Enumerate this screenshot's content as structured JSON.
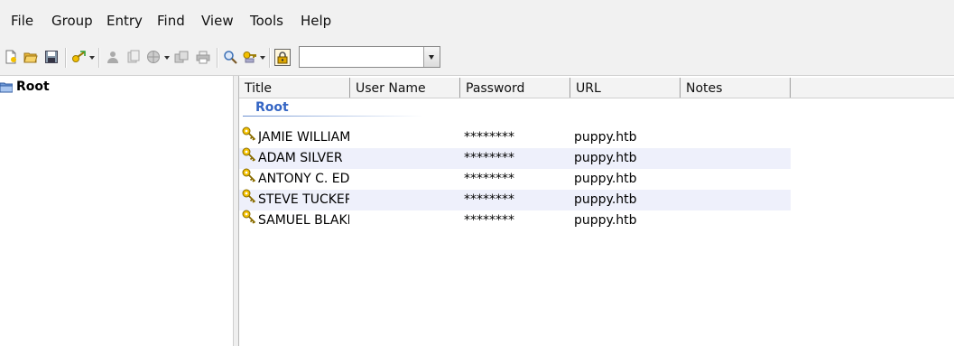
{
  "menu": [
    "File",
    "Group",
    "Entry",
    "Find",
    "View",
    "Tools",
    "Help"
  ],
  "toolbar": {
    "icons": [
      "new-database-icon",
      "open-database-icon",
      "save-database-icon",
      "add-entry-icon",
      "user-icon",
      "copy-icon",
      "globe-icon",
      "duplicate-icon",
      "print-icon",
      "find-icon",
      "key-gen-icon",
      "lock-icon"
    ],
    "quick_find_value": ""
  },
  "tree": {
    "root_label": "Root"
  },
  "list": {
    "columns": [
      "Title",
      "User Name",
      "Password",
      "URL",
      "Notes"
    ],
    "group_title": "Root",
    "rows": [
      {
        "title": "JAMIE WILLIAM",
        "user": "",
        "password": "********",
        "url": "puppy.htb",
        "notes": ""
      },
      {
        "title": "ADAM SILVER",
        "user": "",
        "password": "********",
        "url": "puppy.htb",
        "notes": ""
      },
      {
        "title": "ANTONY C. EDV",
        "user": "",
        "password": "********",
        "url": "puppy.htb",
        "notes": ""
      },
      {
        "title": "STEVE TUCKER",
        "user": "",
        "password": "********",
        "url": "puppy.htb",
        "notes": ""
      },
      {
        "title": "SAMUEL BLAKE",
        "user": "",
        "password": "********",
        "url": "puppy.htb",
        "notes": ""
      }
    ]
  },
  "colors": {
    "group_title": "#3465c4",
    "alt_row": "#eef0fb",
    "key": "#e8b400"
  }
}
